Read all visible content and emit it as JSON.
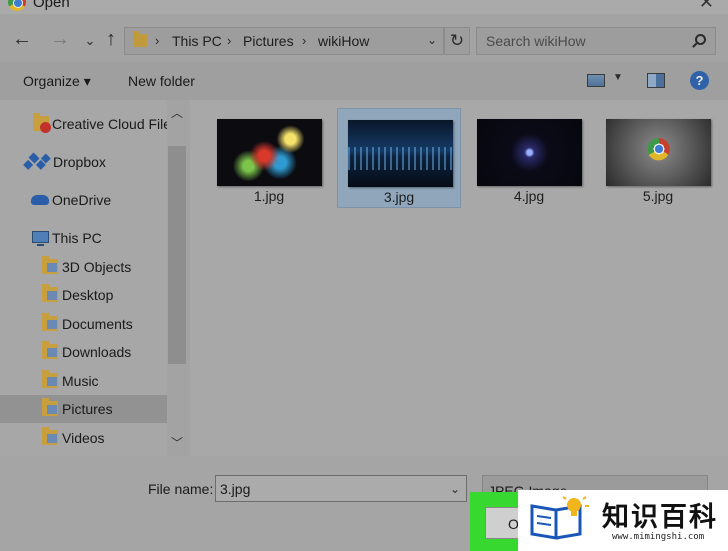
{
  "window": {
    "title": "Open",
    "close_glyph": "✕"
  },
  "nav": {
    "back_glyph": "←",
    "forward_glyph": "→",
    "recent_glyph": "⌄",
    "up_glyph": "↑",
    "refresh_glyph": "↻",
    "breadcrumb": [
      "This PC",
      "Pictures",
      "wikiHow"
    ],
    "search_placeholder": "Search wikiHow"
  },
  "toolbar": {
    "organize_label": "Organize ▾",
    "new_folder_label": "New folder",
    "help_label": "?"
  },
  "sidebar": {
    "items": [
      {
        "label": "Creative Cloud Files",
        "icon": "creative-cloud-folder-icon"
      },
      {
        "label": "Dropbox",
        "icon": "dropbox-icon"
      },
      {
        "label": "OneDrive",
        "icon": "onedrive-icon"
      },
      {
        "label": "This PC",
        "icon": "computer-icon"
      },
      {
        "label": "3D Objects",
        "icon": "folder-icon"
      },
      {
        "label": "Desktop",
        "icon": "folder-icon"
      },
      {
        "label": "Documents",
        "icon": "folder-icon"
      },
      {
        "label": "Downloads",
        "icon": "folder-icon"
      },
      {
        "label": "Music",
        "icon": "folder-icon"
      },
      {
        "label": "Pictures",
        "icon": "folder-icon",
        "selected": true
      },
      {
        "label": "Videos",
        "icon": "folder-icon"
      }
    ]
  },
  "files": [
    {
      "name": "1.jpg"
    },
    {
      "name": "3.jpg",
      "selected": true
    },
    {
      "name": "4.jpg"
    },
    {
      "name": "5.jpg"
    }
  ],
  "footer": {
    "file_name_label": "File name:",
    "file_name_value": "3.jpg",
    "file_type_value": "JPEG Image",
    "open_label": "Open"
  },
  "watermark": {
    "title": "知识百科",
    "url": "www.mimingshi.com"
  },
  "colors": {
    "highlight": "#37d82f",
    "selection": "#8fa6bb"
  }
}
